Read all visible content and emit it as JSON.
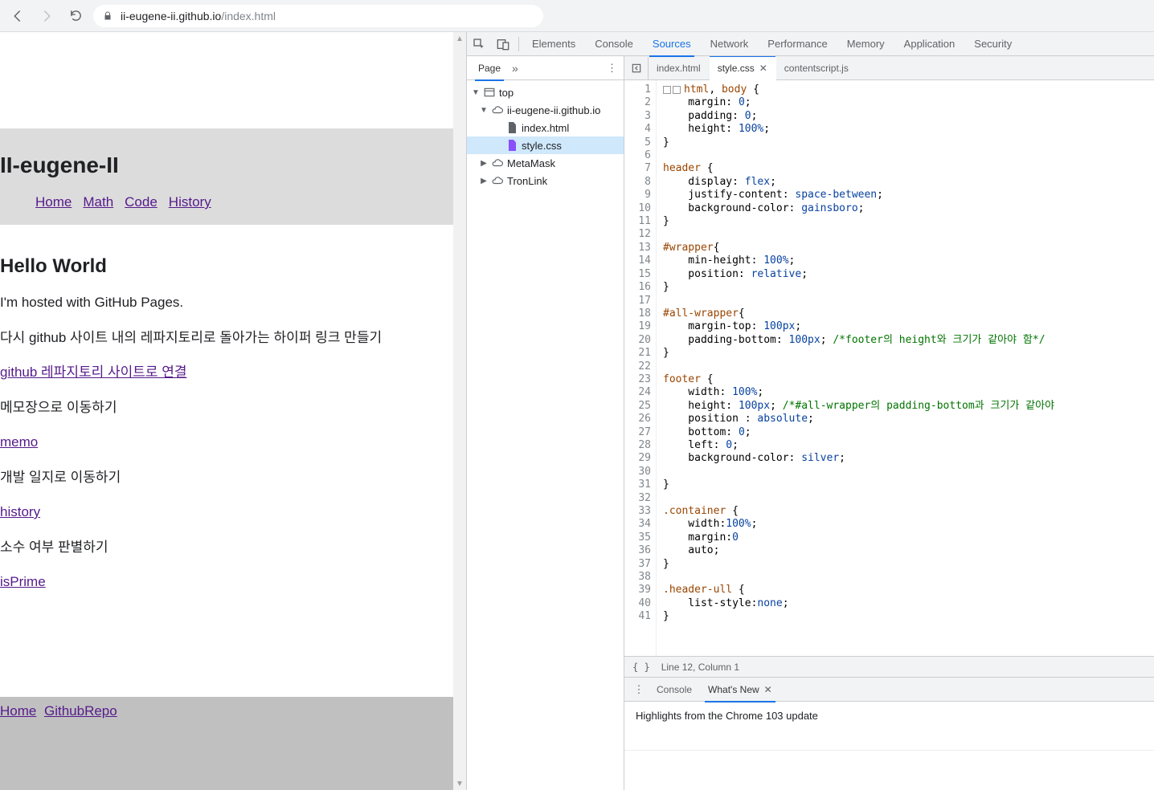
{
  "browser": {
    "url_host": "ii-eugene-ii.github.io",
    "url_path": "/index.html"
  },
  "page": {
    "site_title": "II-eugene-II",
    "nav": [
      "Home",
      "Math",
      "Code",
      "History"
    ],
    "h2": "Hello World",
    "body_lines": [
      "I'm hosted with GitHub Pages.",
      "다시 github 사이트 내의 레파지토리로 돌아가는 하이퍼 링크 만들기",
      "github 레파지토리 사이트로 연결",
      "메모장으로 이동하기",
      "memo",
      "개발 일지로 이동하기",
      "history",
      "소수 여부 판별하기",
      "isPrime"
    ],
    "footer_links": [
      "Home",
      "GithubRepo"
    ]
  },
  "devtools": {
    "panels": [
      "Elements",
      "Console",
      "Sources",
      "Network",
      "Performance",
      "Memory",
      "Application",
      "Security"
    ],
    "active_panel": "Sources",
    "sources_nav": {
      "tab": "Page",
      "tree": {
        "top": "top",
        "origin": "ii-eugene-ii.github.io",
        "files": [
          "index.html",
          "style.css"
        ],
        "ext1": "MetaMask",
        "ext2": "TronLink"
      },
      "selected_file": "style.css"
    },
    "editor_tabs": [
      "index.html",
      "style.css",
      "contentscript.js"
    ],
    "editor_active": "style.css",
    "status": "Line 12, Column 1",
    "code_lines": [
      [
        [
          "sel",
          "html"
        ],
        [
          "punc",
          ", "
        ],
        [
          "sel",
          "body"
        ],
        [
          "punc",
          " {"
        ]
      ],
      [
        [
          "prop",
          "    margin"
        ],
        [
          "punc",
          ": "
        ],
        [
          "val",
          "0"
        ],
        [
          "punc",
          ";"
        ]
      ],
      [
        [
          "prop",
          "    padding"
        ],
        [
          "punc",
          ": "
        ],
        [
          "val",
          "0"
        ],
        [
          "punc",
          ";"
        ]
      ],
      [
        [
          "prop",
          "    height"
        ],
        [
          "punc",
          ": "
        ],
        [
          "val",
          "100%"
        ],
        [
          "punc",
          ";"
        ]
      ],
      [
        [
          "punc",
          "}"
        ]
      ],
      [],
      [
        [
          "sel",
          "header"
        ],
        [
          "punc",
          " {"
        ]
      ],
      [
        [
          "prop",
          "    display"
        ],
        [
          "punc",
          ": "
        ],
        [
          "val",
          "flex"
        ],
        [
          "punc",
          ";"
        ]
      ],
      [
        [
          "prop",
          "    justify-content"
        ],
        [
          "punc",
          ": "
        ],
        [
          "val",
          "space-between"
        ],
        [
          "punc",
          ";"
        ]
      ],
      [
        [
          "prop",
          "    background-color"
        ],
        [
          "punc",
          ": "
        ],
        [
          "val",
          "gainsboro"
        ],
        [
          "punc",
          ";"
        ]
      ],
      [
        [
          "punc",
          "}"
        ]
      ],
      [],
      [
        [
          "sel",
          "#wrapper"
        ],
        [
          "punc",
          "{"
        ]
      ],
      [
        [
          "prop",
          "    min-height"
        ],
        [
          "punc",
          ": "
        ],
        [
          "val",
          "100%"
        ],
        [
          "punc",
          ";"
        ]
      ],
      [
        [
          "prop",
          "    position"
        ],
        [
          "punc",
          ": "
        ],
        [
          "val",
          "relative"
        ],
        [
          "punc",
          ";"
        ]
      ],
      [
        [
          "punc",
          "}"
        ]
      ],
      [],
      [
        [
          "sel",
          "#all-wrapper"
        ],
        [
          "punc",
          "{"
        ]
      ],
      [
        [
          "prop",
          "    margin-top"
        ],
        [
          "punc",
          ": "
        ],
        [
          "val",
          "100px"
        ],
        [
          "punc",
          ";"
        ]
      ],
      [
        [
          "prop",
          "    padding-bottom"
        ],
        [
          "punc",
          ": "
        ],
        [
          "val",
          "100px"
        ],
        [
          "punc",
          "; "
        ],
        [
          "comment",
          "/*footer의 height와 크기가 같아야 함*/"
        ]
      ],
      [
        [
          "punc",
          "}"
        ]
      ],
      [],
      [
        [
          "sel",
          "footer"
        ],
        [
          "punc",
          " {"
        ]
      ],
      [
        [
          "prop",
          "    width"
        ],
        [
          "punc",
          ": "
        ],
        [
          "val",
          "100%"
        ],
        [
          "punc",
          ";"
        ]
      ],
      [
        [
          "prop",
          "    height"
        ],
        [
          "punc",
          ": "
        ],
        [
          "val",
          "100px"
        ],
        [
          "punc",
          "; "
        ],
        [
          "comment",
          "/*#all-wrapper의 padding-bottom과 크기가 같아야"
        ]
      ],
      [
        [
          "prop",
          "    position "
        ],
        [
          "punc",
          ": "
        ],
        [
          "val",
          "absolute"
        ],
        [
          "punc",
          ";"
        ]
      ],
      [
        [
          "prop",
          "    bottom"
        ],
        [
          "punc",
          ": "
        ],
        [
          "val",
          "0"
        ],
        [
          "punc",
          ";"
        ]
      ],
      [
        [
          "prop",
          "    left"
        ],
        [
          "punc",
          ": "
        ],
        [
          "val",
          "0"
        ],
        [
          "punc",
          ";"
        ]
      ],
      [
        [
          "prop",
          "    background-color"
        ],
        [
          "punc",
          ": "
        ],
        [
          "val",
          "silver"
        ],
        [
          "punc",
          ";"
        ]
      ],
      [],
      [
        [
          "punc",
          "}"
        ]
      ],
      [],
      [
        [
          "sel",
          ".container"
        ],
        [
          "punc",
          " {"
        ]
      ],
      [
        [
          "prop",
          "    width"
        ],
        [
          "punc",
          ":"
        ],
        [
          "val",
          "100%"
        ],
        [
          "punc",
          ";"
        ]
      ],
      [
        [
          "prop",
          "    margin"
        ],
        [
          "punc",
          ":"
        ],
        [
          "val",
          "0"
        ]
      ],
      [
        [
          "prop",
          "    auto"
        ],
        [
          "punc",
          ";"
        ]
      ],
      [
        [
          "punc",
          "}"
        ]
      ],
      [],
      [
        [
          "sel",
          ".header-ull"
        ],
        [
          "punc",
          " {"
        ]
      ],
      [
        [
          "prop",
          "    list-style"
        ],
        [
          "punc",
          ":"
        ],
        [
          "val",
          "none"
        ],
        [
          "punc",
          ";"
        ]
      ],
      [
        [
          "punc",
          "}"
        ]
      ]
    ]
  },
  "drawer": {
    "tabs": [
      "Console",
      "What's New"
    ],
    "active": "What's New",
    "body": "Highlights from the Chrome 103 update"
  }
}
